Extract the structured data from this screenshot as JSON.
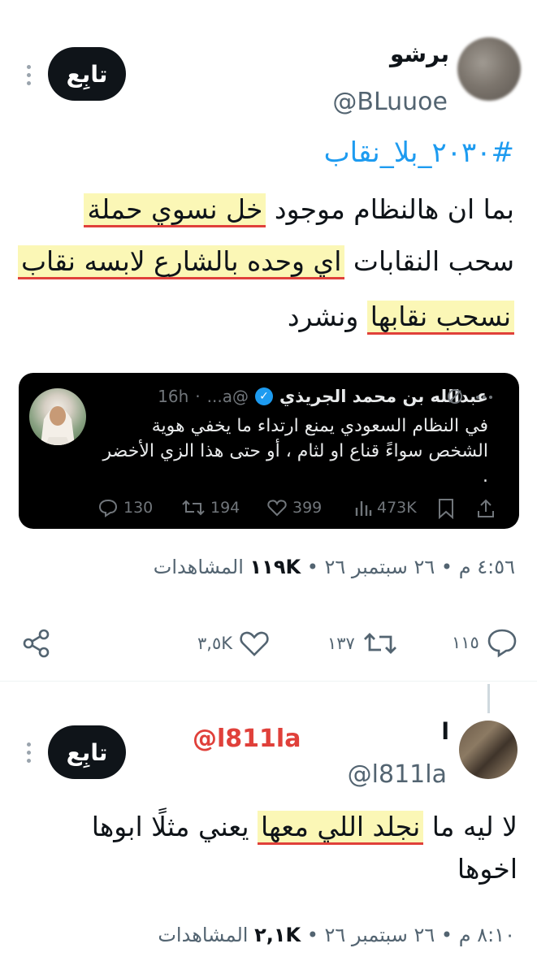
{
  "tweet": {
    "author_name": "برشو",
    "author_handle": "@BLuuoe",
    "follow_label": "تابِع",
    "hashtag": "#٢٠٣٠_بلا_نقاب",
    "lines": [
      {
        "before": "بما ان هالنظام موجود ",
        "highlight": "خل نسوي حملة",
        "after": ""
      },
      {
        "before": "سحب النقابات ",
        "highlight": "اي وحده بالشارع لابسه نقاب",
        "after": ""
      },
      {
        "before": "",
        "highlight": "نسحب نقابها",
        "after": " ونشرد"
      }
    ],
    "time": "٤:٥٦ م",
    "date": "٢٦ سبتمبر ٢٦",
    "views_count": "١١٩K",
    "views_label": "المشاهدات",
    "replies": "١١٥",
    "retweets": "١٣٧",
    "likes": "٣,٥K"
  },
  "quoted": {
    "name": "عبدالله بن محمد الجريذي",
    "handle": "@a...",
    "time": "16h",
    "text_lines": [
      "في النظام السعودي يمنع ارتداء ما يخفي هوية",
      "الشخص سواءً قناع او لثام ، أو حتى هذا الزي الأخضر",
      "."
    ],
    "replies": "130",
    "retweets": "194",
    "likes": "399",
    "views": "473K"
  },
  "reply": {
    "author_name": "ا",
    "author_handle": "@l811la",
    "watermark": "@l811la",
    "follow_label": "تابِع",
    "lines": [
      {
        "before": "لا ليه ما ",
        "highlight": "نجلد اللي معها",
        "after": " يعني مثلًا ابوها"
      },
      {
        "before": "اخوها",
        "highlight": "",
        "after": ""
      }
    ],
    "time": "٨:١٠ م",
    "date": "٢٦ سبتمبر ٢٦",
    "views_count": "٢,١K",
    "views_label": "المشاهدات"
  },
  "colors": {
    "accent": "#1d9bf0",
    "highlight": "#fbf7b6",
    "underline": "#e0403a",
    "text": "#0f1419",
    "muted": "#536471"
  },
  "icons": [
    "more-icon",
    "verified-icon",
    "reply-icon",
    "retweet-icon",
    "like-icon",
    "views-icon",
    "bookmark-icon",
    "share-icon",
    "grok-icon"
  ]
}
